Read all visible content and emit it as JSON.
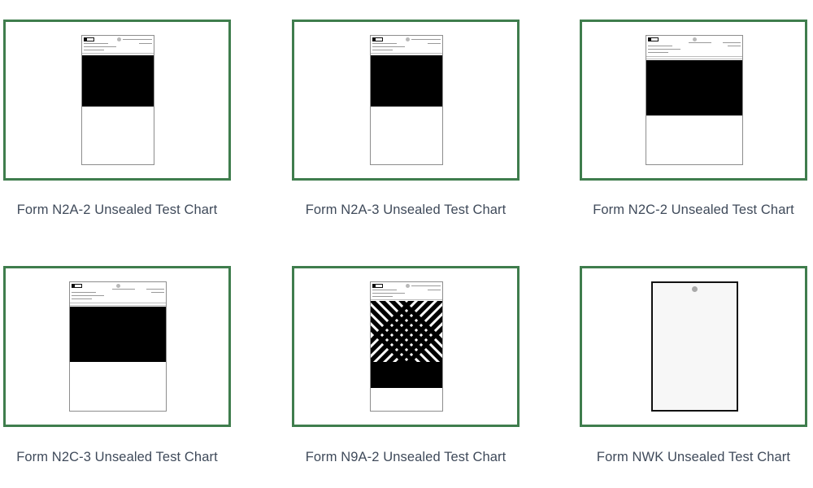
{
  "products": [
    {
      "title": "Form N2A-2 Unsealed Test Chart",
      "thumbnail": "form-document-black-block"
    },
    {
      "title": "Form N2A-3 Unsealed Test Chart",
      "thumbnail": "form-document-black-block"
    },
    {
      "title": "Form N2C-2 Unsealed Test Chart",
      "thumbnail": "wide-form-document-black-block"
    },
    {
      "title": "Form N2C-3 Unsealed Test Chart",
      "thumbnail": "wide-form-document-black-block"
    },
    {
      "title": "Form N9A-2 Unsealed Test Chart",
      "thumbnail": "form-document-chevron-pattern"
    },
    {
      "title": "Form NWK Unsealed Test Chart",
      "thumbnail": "blank-card-with-hole"
    }
  ],
  "colors": {
    "card_border": "#3f7d4d",
    "caption_text": "#3f4a5a"
  }
}
